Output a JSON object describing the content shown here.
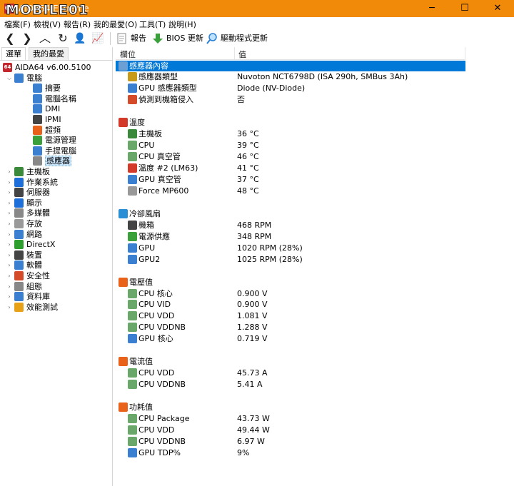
{
  "window": {
    "title": "AIDA64 Extreme",
    "watermark": "MOBILE01",
    "minimize_glyph": "─",
    "maximize_glyph": "☐",
    "close_glyph": "✕"
  },
  "menu": [
    "檔案(F)",
    "檢視(V)",
    "報告(R)",
    "我的最愛(O)",
    "工具(T)",
    "說明(H)"
  ],
  "toolbar": {
    "back_glyph": "❮",
    "forward_glyph": "❯",
    "up_glyph": "︿",
    "refresh_glyph": "↻",
    "user_glyph": "👤",
    "chart_glyph": "📈",
    "report_label": "報告",
    "bios_label": "BIOS 更新",
    "driver_label": "驅動程式更新"
  },
  "tabs": {
    "menu": "選單",
    "favorites": "我的最愛"
  },
  "tree": {
    "root": "AIDA64 v6.00.5100",
    "items": [
      {
        "label": "電腦",
        "level": 1,
        "expanded": true,
        "color": "#3b7fd0"
      },
      {
        "label": "摘要",
        "level": 2,
        "color": "#3b7fd0"
      },
      {
        "label": "電腦名稱",
        "level": 2,
        "color": "#3b7fd0"
      },
      {
        "label": "DMI",
        "level": 2,
        "color": "#3b7fd0"
      },
      {
        "label": "IPMI",
        "level": 2,
        "color": "#444444"
      },
      {
        "label": "超頻",
        "level": 2,
        "color": "#e8621a"
      },
      {
        "label": "電源管理",
        "level": 2,
        "color": "#3aa03a"
      },
      {
        "label": "手提電腦",
        "level": 2,
        "color": "#3b7fd0"
      },
      {
        "label": "感應器",
        "level": 2,
        "color": "#888888",
        "selected": true
      },
      {
        "label": "主機板",
        "level": 1,
        "color": "#3b8a3b"
      },
      {
        "label": "作業系統",
        "level": 1,
        "color": "#1e6fd9"
      },
      {
        "label": "伺服器",
        "level": 1,
        "color": "#444444"
      },
      {
        "label": "顯示",
        "level": 1,
        "color": "#1e6fd9"
      },
      {
        "label": "多媒體",
        "level": 1,
        "color": "#888888"
      },
      {
        "label": "存放",
        "level": 1,
        "color": "#999999"
      },
      {
        "label": "網路",
        "level": 1,
        "color": "#3b7fd0"
      },
      {
        "label": "DirectX",
        "level": 1,
        "color": "#2e9e2e"
      },
      {
        "label": "裝置",
        "level": 1,
        "color": "#444444"
      },
      {
        "label": "軟體",
        "level": 1,
        "color": "#3b7fd0"
      },
      {
        "label": "安全性",
        "level": 1,
        "color": "#d44b2a"
      },
      {
        "label": "組態",
        "level": 1,
        "color": "#888888"
      },
      {
        "label": "資料庫",
        "level": 1,
        "color": "#3b7fd0"
      },
      {
        "label": "效能測試",
        "level": 1,
        "color": "#e8a21a"
      }
    ]
  },
  "columns": {
    "field": "欄位",
    "value": "值"
  },
  "rows": [
    {
      "type": "section",
      "field": "感應器內容",
      "value": "",
      "color": "#6c9fd4",
      "highlight": true
    },
    {
      "type": "item",
      "field": "感應器類型",
      "value": "Nuvoton NCT6798D  (ISA 290h, SMBus 3Ah)",
      "color": "#c79a1a"
    },
    {
      "type": "item",
      "field": "GPU 感應器類型",
      "value": "Diode  (NV-Diode)",
      "color": "#3b7fd0"
    },
    {
      "type": "item",
      "field": "偵測到機箱侵入",
      "value": "否",
      "color": "#d44b2a"
    },
    {
      "type": "gap"
    },
    {
      "type": "section",
      "field": "溫度",
      "value": "",
      "color": "#d43a2a"
    },
    {
      "type": "item",
      "field": "主機板",
      "value": "36 °C",
      "color": "#3b8a3b"
    },
    {
      "type": "item",
      "field": "CPU",
      "value": "39 °C",
      "color": "#6aa86a"
    },
    {
      "type": "item",
      "field": "CPU 真空管",
      "value": "46 °C",
      "color": "#6aa86a"
    },
    {
      "type": "item",
      "field": "溫度 #2 (LM63)",
      "value": "41 °C",
      "color": "#d43a2a"
    },
    {
      "type": "item",
      "field": "GPU 真空管",
      "value": "37 °C",
      "color": "#3b7fd0"
    },
    {
      "type": "item",
      "field": "Force MP600",
      "value": "48 °C",
      "color": "#999999"
    },
    {
      "type": "gap"
    },
    {
      "type": "section",
      "field": "冷卻風扇",
      "value": "",
      "color": "#2a8fd4"
    },
    {
      "type": "item",
      "field": "機箱",
      "value": "468 RPM",
      "color": "#444444"
    },
    {
      "type": "item",
      "field": "電源供應",
      "value": "348 RPM",
      "color": "#3aa03a"
    },
    {
      "type": "item",
      "field": "GPU",
      "value": "1020 RPM  (28%)",
      "color": "#3b7fd0"
    },
    {
      "type": "item",
      "field": "GPU2",
      "value": "1025 RPM  (28%)",
      "color": "#3b7fd0"
    },
    {
      "type": "gap"
    },
    {
      "type": "section",
      "field": "電壓值",
      "value": "",
      "color": "#e8621a"
    },
    {
      "type": "item",
      "field": "CPU 核心",
      "value": "0.900 V",
      "color": "#6aa86a"
    },
    {
      "type": "item",
      "field": "CPU VID",
      "value": "0.900 V",
      "color": "#6aa86a"
    },
    {
      "type": "item",
      "field": "CPU VDD",
      "value": "1.081 V",
      "color": "#6aa86a"
    },
    {
      "type": "item",
      "field": "CPU VDDNB",
      "value": "1.288 V",
      "color": "#6aa86a"
    },
    {
      "type": "item",
      "field": "GPU 核心",
      "value": "0.719 V",
      "color": "#3b7fd0"
    },
    {
      "type": "gap"
    },
    {
      "type": "section",
      "field": "電流值",
      "value": "",
      "color": "#e8621a"
    },
    {
      "type": "item",
      "field": "CPU VDD",
      "value": "45.73 A",
      "color": "#6aa86a"
    },
    {
      "type": "item",
      "field": "CPU VDDNB",
      "value": "5.41 A",
      "color": "#6aa86a"
    },
    {
      "type": "gap"
    },
    {
      "type": "section",
      "field": "功耗值",
      "value": "",
      "color": "#e8621a"
    },
    {
      "type": "item",
      "field": "CPU Package",
      "value": "43.73 W",
      "color": "#6aa86a"
    },
    {
      "type": "item",
      "field": "CPU VDD",
      "value": "49.44 W",
      "color": "#6aa86a"
    },
    {
      "type": "item",
      "field": "CPU VDDNB",
      "value": "6.97 W",
      "color": "#6aa86a"
    },
    {
      "type": "item",
      "field": "GPU TDP%",
      "value": "9%",
      "color": "#3b7fd0"
    }
  ]
}
